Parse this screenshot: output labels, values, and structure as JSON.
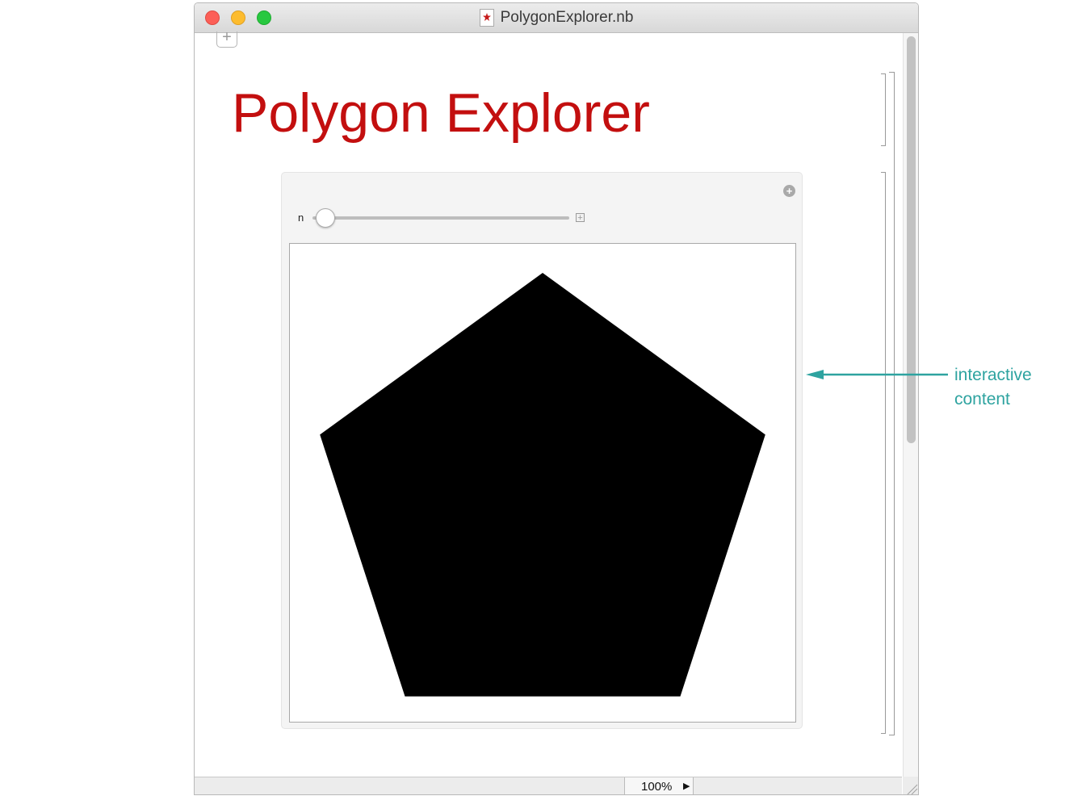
{
  "window": {
    "title": "PolygonExplorer.nb"
  },
  "notebook": {
    "title": "Polygon Explorer"
  },
  "manipulate": {
    "control_label": "n",
    "n_value": 5,
    "slider_fraction": 0.0
  },
  "statusbar": {
    "zoom_label": "100%"
  },
  "annotation": {
    "line1": "interactive",
    "line2": "content"
  },
  "colors": {
    "title": "#c30f0f",
    "annotation": "#2ea3a0",
    "polygon_fill": "#000000"
  },
  "icons": {
    "insert_cell": "plus-icon",
    "panel_options": "plus-circle-icon",
    "slider_expand": "plus-square-icon",
    "zoom_menu": "triangle-right-icon",
    "document": "mathematica-spikey-icon"
  }
}
